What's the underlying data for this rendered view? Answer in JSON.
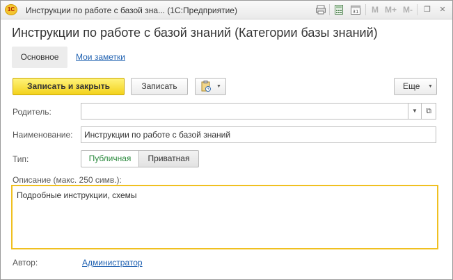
{
  "titlebar": {
    "logo": "1С",
    "text": "Инструкции по работе с базой зна... (1С:Предприятие)",
    "icons": [
      "print-icon",
      "calculator-icon",
      "calendar-icon"
    ],
    "calendar_day": "31",
    "memory": [
      "M",
      "M+",
      "M-"
    ],
    "window_controls": [
      "restore-icon",
      "close-icon"
    ],
    "restore_glyph": "❐",
    "close_glyph": "✕"
  },
  "form": {
    "title": "Инструкции по работе с базой знаний (Категории базы знаний)"
  },
  "tabs": {
    "main": "Основное",
    "notes": "Мои заметки"
  },
  "toolbar": {
    "save_close": "Записать и закрыть",
    "save": "Записать",
    "more": "Еще",
    "dropdown_glyph": "▼"
  },
  "fields": {
    "parent": {
      "label": "Родитель:",
      "value": "",
      "open_glyph": "⧉"
    },
    "name": {
      "label": "Наименование:",
      "value": "Инструкции по работе с базой знаний"
    },
    "type": {
      "label": "Тип:",
      "options": [
        "Публичная",
        "Приватная"
      ],
      "selected": "Публичная"
    },
    "description": {
      "label": "Описание (макс. 250 симв.):",
      "value": "Подробные инструкции, схемы"
    },
    "author": {
      "label": "Автор:",
      "value": "Администратор"
    }
  },
  "colors": {
    "accent_yellow": "#f3d21c",
    "link_blue": "#1c5fb0",
    "selected_green": "#2b8a3e",
    "focus_border": "#f0c020"
  }
}
